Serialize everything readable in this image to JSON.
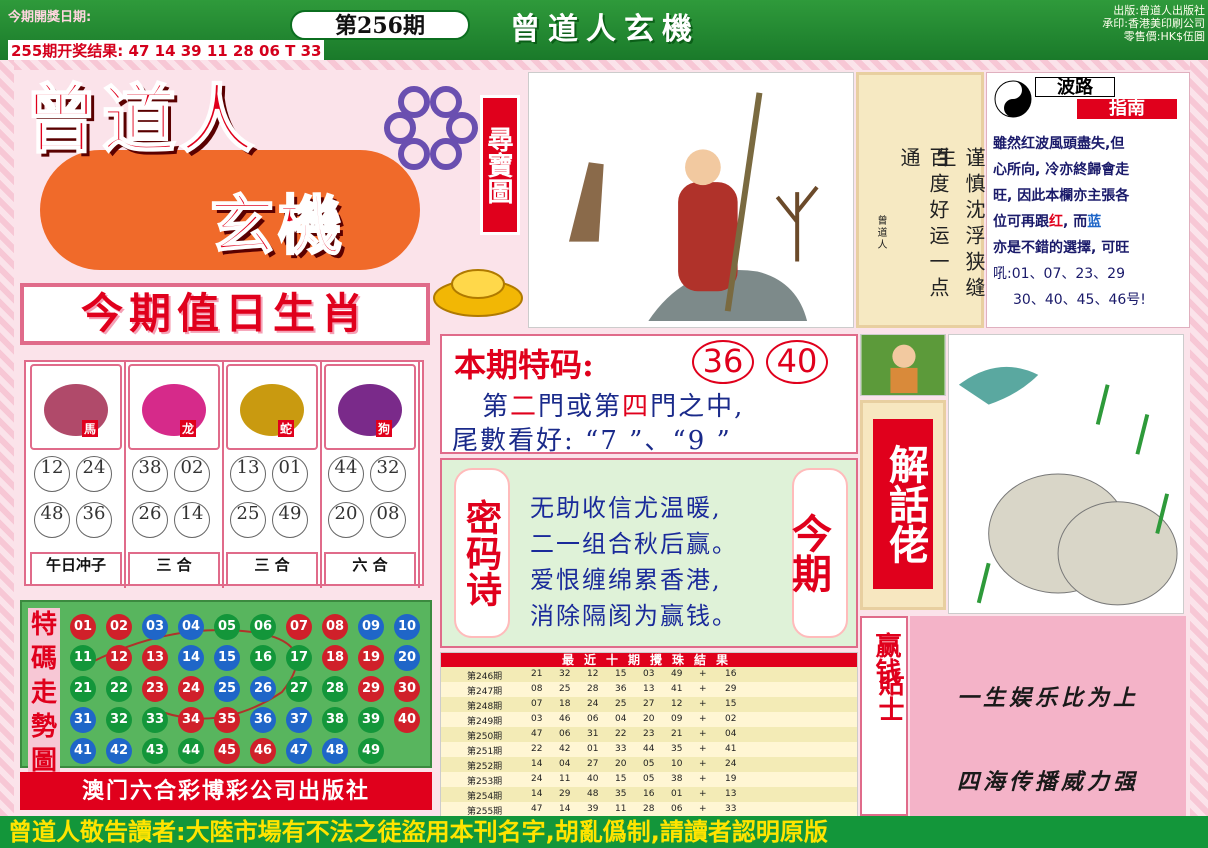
{
  "header": {
    "open_date_label": "今期開獎日期:",
    "last_result": "255期开奖结果: 47 14 39 11 28 06 T 33",
    "issue": "第256期",
    "banner": "曾道人玄機",
    "publisher_lines": [
      "出版:曾道人出版社",
      "承印:香港美印刷公司",
      "零售價:HK$伍圓"
    ]
  },
  "logo": {
    "line1": "曾道人",
    "line2": "玄機",
    "side": "尋寶圖"
  },
  "scroll": {
    "col1": "谨慎沈浮狭缝生",
    "col2": "百度好运一点通",
    "signature": "曾道人"
  },
  "wave_guide": {
    "title_top": "波路",
    "title_bottom": "指南",
    "lines": [
      "雖然红波風頭盡失,但",
      "心所向, 冷亦終歸會走",
      "旺, 因此本欄亦主張各"
    ],
    "line4_a": "位可再跟",
    "red_word": "红",
    "line4_b": ", 而",
    "blue_word": "蓝",
    "line5": "亦是不錯的選擇, 可旺",
    "numbers_line1": "吼:01、07、23、29",
    "numbers_line2": "30、40、45、46号!"
  },
  "zodiac": {
    "title": "今期值日生肖",
    "columns": [
      {
        "icon": "horse-icon",
        "tag": "馬",
        "numbers": [
          "12",
          "24",
          "48",
          "36"
        ],
        "label": "午日冲子"
      },
      {
        "icon": "dragon-icon",
        "tag": "龙",
        "numbers": [
          "38",
          "02",
          "26",
          "14"
        ],
        "label": "三 合"
      },
      {
        "icon": "snake-icon",
        "tag": "蛇",
        "numbers": [
          "13",
          "01",
          "25",
          "49"
        ],
        "label": "三 合"
      },
      {
        "icon": "dog-icon",
        "tag": "狗",
        "numbers": [
          "44",
          "32",
          "20",
          "08"
        ],
        "label": "六 合"
      }
    ]
  },
  "trend": {
    "title": "特碼走勢圖",
    "balls": [
      [
        "01",
        "r"
      ],
      [
        "02",
        "r"
      ],
      [
        "03",
        "b"
      ],
      [
        "04",
        "b"
      ],
      [
        "05",
        "g"
      ],
      [
        "06",
        "g"
      ],
      [
        "07",
        "r"
      ],
      [
        "08",
        "r"
      ],
      [
        "09",
        "b"
      ],
      [
        "10",
        "b"
      ],
      [
        "11",
        "g"
      ],
      [
        "12",
        "r"
      ],
      [
        "13",
        "r"
      ],
      [
        "14",
        "b"
      ],
      [
        "15",
        "b"
      ],
      [
        "16",
        "g"
      ],
      [
        "17",
        "g"
      ],
      [
        "18",
        "r"
      ],
      [
        "19",
        "r"
      ],
      [
        "20",
        "b"
      ],
      [
        "21",
        "g"
      ],
      [
        "22",
        "g"
      ],
      [
        "23",
        "r"
      ],
      [
        "24",
        "r"
      ],
      [
        "25",
        "b"
      ],
      [
        "26",
        "b"
      ],
      [
        "27",
        "g"
      ],
      [
        "28",
        "g"
      ],
      [
        "29",
        "r"
      ],
      [
        "30",
        "r"
      ],
      [
        "31",
        "b"
      ],
      [
        "32",
        "g"
      ],
      [
        "33",
        "g"
      ],
      [
        "34",
        "r"
      ],
      [
        "35",
        "r"
      ],
      [
        "36",
        "b"
      ],
      [
        "37",
        "b"
      ],
      [
        "38",
        "g"
      ],
      [
        "39",
        "g"
      ],
      [
        "40",
        "r"
      ],
      [
        "41",
        "b"
      ],
      [
        "42",
        "b"
      ],
      [
        "43",
        "g"
      ],
      [
        "44",
        "g"
      ],
      [
        "45",
        "r"
      ],
      [
        "46",
        "r"
      ],
      [
        "47",
        "b"
      ],
      [
        "48",
        "b"
      ],
      [
        "49",
        "g"
      ]
    ],
    "publisher": "澳门六合彩博彩公司出版社"
  },
  "special": {
    "title": "本期特码:",
    "numbers": [
      "36",
      "40"
    ],
    "line1_a": "第",
    "door1": "二",
    "line1_b": "門或第",
    "door2": "四",
    "line1_c": "門之中,",
    "line2": "尾數看好: “7 ”、“9 ”"
  },
  "mima": {
    "left": "密码诗",
    "right": "今期",
    "poem": [
      "无助收信尤温暖,",
      "二一组合秋后赢。",
      "爱恨缠绵累香港,",
      "消除隔阂为赢钱。"
    ]
  },
  "results": {
    "title": "最近十期攪珠結果",
    "rows": [
      [
        "第246期",
        "21",
        "32",
        "12",
        "15",
        "03",
        "49",
        "+",
        "16"
      ],
      [
        "第247期",
        "08",
        "25",
        "28",
        "36",
        "13",
        "41",
        "+",
        "29"
      ],
      [
        "第248期",
        "07",
        "18",
        "24",
        "25",
        "27",
        "12",
        "+",
        "15"
      ],
      [
        "第249期",
        "03",
        "46",
        "06",
        "04",
        "20",
        "09",
        "+",
        "02"
      ],
      [
        "第250期",
        "47",
        "06",
        "31",
        "22",
        "23",
        "21",
        "+",
        "04"
      ],
      [
        "第251期",
        "22",
        "42",
        "01",
        "33",
        "44",
        "35",
        "+",
        "41"
      ],
      [
        "第252期",
        "14",
        "04",
        "27",
        "20",
        "05",
        "10",
        "+",
        "24"
      ],
      [
        "第253期",
        "24",
        "11",
        "40",
        "15",
        "05",
        "38",
        "+",
        "19"
      ],
      [
        "第254期",
        "14",
        "29",
        "48",
        "35",
        "16",
        "01",
        "+",
        "13"
      ],
      [
        "第255期",
        "47",
        "14",
        "39",
        "11",
        "28",
        "06",
        "+",
        "33"
      ]
    ]
  },
  "jiehua": {
    "text": "解話佬"
  },
  "tips": {
    "side1": "赢钱",
    "side2": "貼士",
    "line1": "一生娱乐比为上",
    "line2": "四海传播威力强"
  },
  "footer": {
    "text": "曾道人敬告讀者:大陸市場有不法之徒盜用本刊名字,胡亂僞制,請讀者認明原版"
  }
}
